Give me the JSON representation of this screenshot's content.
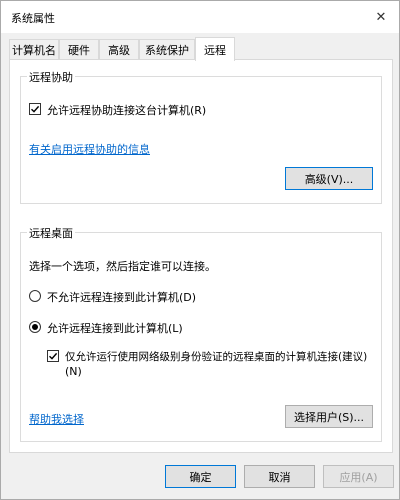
{
  "window": {
    "title": "系统属性",
    "close_glyph": "✕"
  },
  "tabs": [
    {
      "label": "计算机名"
    },
    {
      "label": "硬件"
    },
    {
      "label": "高级"
    },
    {
      "label": "系统保护"
    },
    {
      "label": "远程"
    }
  ],
  "active_tab": 4,
  "remote_assistance": {
    "group_label": "远程协助",
    "allow_checkbox_label": "允许远程协助连接这台计算机(R)",
    "allow_checked": true,
    "info_link": "有关启用远程协助的信息",
    "advanced_button": "高级(V)..."
  },
  "remote_desktop": {
    "group_label": "远程桌面",
    "instruction": "选择一个选项，然后指定谁可以连接。",
    "option_disallow": "不允许远程连接到此计算机(D)",
    "option_allow": "允许远程连接到此计算机(L)",
    "selected_option": "allow",
    "nla_label_line1": "仅允许运行使用网络级别身份验证的远程桌面的计算机连接(建议)",
    "nla_label_line2": "(N)",
    "nla_checked": true,
    "help_link": "帮助我选择",
    "select_users_button": "选择用户(S)..."
  },
  "footer": {
    "ok": "确定",
    "cancel": "取消",
    "apply": "应用(A)"
  },
  "colors": {
    "link": "#0066cc",
    "focus": "#0078d7"
  }
}
